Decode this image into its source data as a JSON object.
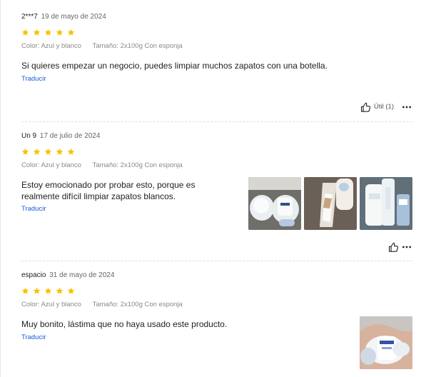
{
  "reviews": [
    {
      "reviewer": "2***7",
      "date": "19 de mayo de 2024",
      "rating": 5,
      "attributes": {
        "color": "Color: Azul y blanco",
        "size": "Tamaño: 2x100g Con esponja"
      },
      "text_lines": [
        "Si quieres empezar un negocio, puedes limpiar muchos zapatos con una botella."
      ],
      "translate_label": "Traducir",
      "useful_label": "Útil (1)",
      "photo_icons": []
    },
    {
      "reviewer": "Un 9",
      "date": "17 de julio de 2024",
      "rating": 5,
      "attributes": {
        "color": "Color: Azul y blanco",
        "size": "Tamaño: 2x100g Con esponja"
      },
      "text_lines": [
        "Estoy emocionado por probar esto, porque es",
        "realmente difícil limpiar zapatos blancos."
      ],
      "translate_label": "Traducir",
      "useful_label": "",
      "photo_icons": [
        "product-photo-1",
        "product-photo-2",
        "product-photo-3"
      ]
    },
    {
      "reviewer": "espacio",
      "date": "31 de mayo de 2024",
      "rating": 5,
      "attributes": {
        "color": "Color: Azul y blanco",
        "size": "Tamaño: 2x100g Con esponja"
      },
      "text_lines": [
        "Muy bonito, lástima que no haya usado este producto."
      ],
      "translate_label": "Traducir",
      "useful_label": "",
      "photo_icons": [
        "product-photo-4"
      ]
    }
  ],
  "colors": {
    "star": "#f7c300",
    "link": "#155bd5",
    "muted": "#8a8a8a",
    "text": "#222222",
    "divider": "#e0e0e0"
  },
  "icons": {
    "rating": "star-icon",
    "useful": "thumbs-up-icon",
    "more": "more-options-icon"
  }
}
